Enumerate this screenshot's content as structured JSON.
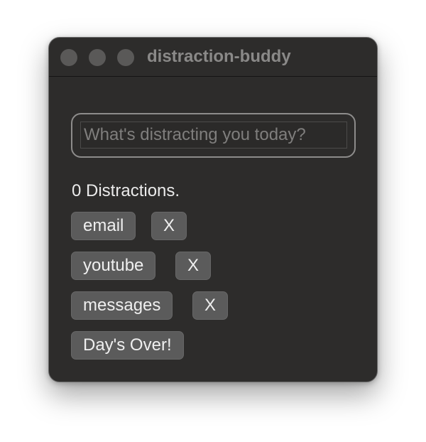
{
  "window": {
    "title": "distraction-buddy"
  },
  "input": {
    "placeholder": "What's distracting you today?",
    "value": ""
  },
  "count_label": "0 Distractions.",
  "distractions": [
    {
      "label": "email",
      "remove_label": "X"
    },
    {
      "label": "youtube",
      "remove_label": "X"
    },
    {
      "label": "messages",
      "remove_label": "X"
    }
  ],
  "end_button_label": "Day's Over!",
  "colors": {
    "window_bg": "#2d2c2b",
    "button_bg": "#5b5b5b",
    "text": "#efefef",
    "title_text": "#8a8988"
  }
}
